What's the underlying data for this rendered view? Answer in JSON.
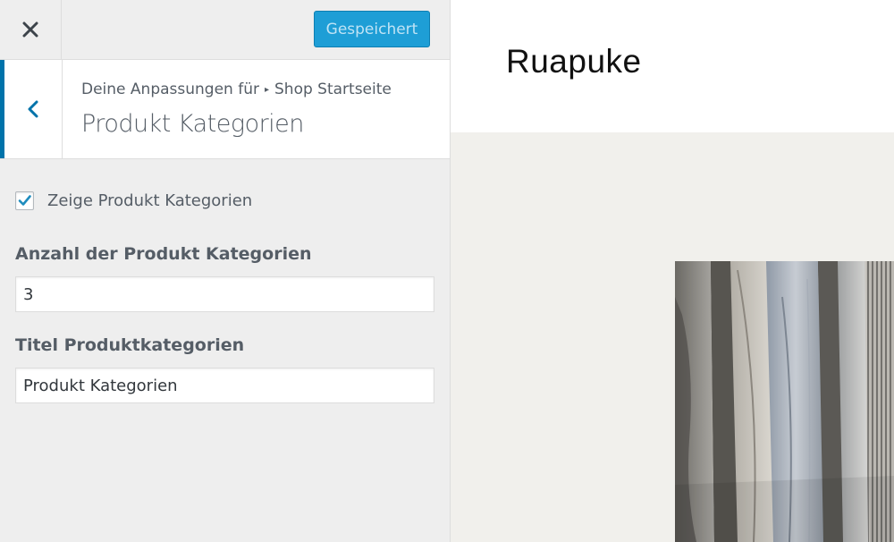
{
  "toolbar": {
    "close_icon": "close-icon",
    "save_label": "Gespeichert"
  },
  "section": {
    "back_icon": "chevron-left-icon",
    "breadcrumb_prefix": "Deine Anpassungen für",
    "breadcrumb_separator": "▸",
    "breadcrumb_parent": "Shop Startseite",
    "title": "Produkt Kategorien"
  },
  "controls": {
    "show_categories": {
      "label": "Zeige Produkt Kategorien",
      "checked": true
    },
    "count": {
      "label": "Anzahl der Produkt Kategorien",
      "value": "3"
    },
    "title": {
      "label": "Titel Produktkategorien",
      "value": "Produkt Kategorien"
    }
  },
  "preview": {
    "site_title": "Ruapuke",
    "hero_image": "hanging-clothes-photo"
  },
  "colors": {
    "accent": "#0073aa",
    "save_button": "#1e9ed6",
    "sidebar_bg": "#eeeeee",
    "preview_bg": "#f1f0ec"
  }
}
